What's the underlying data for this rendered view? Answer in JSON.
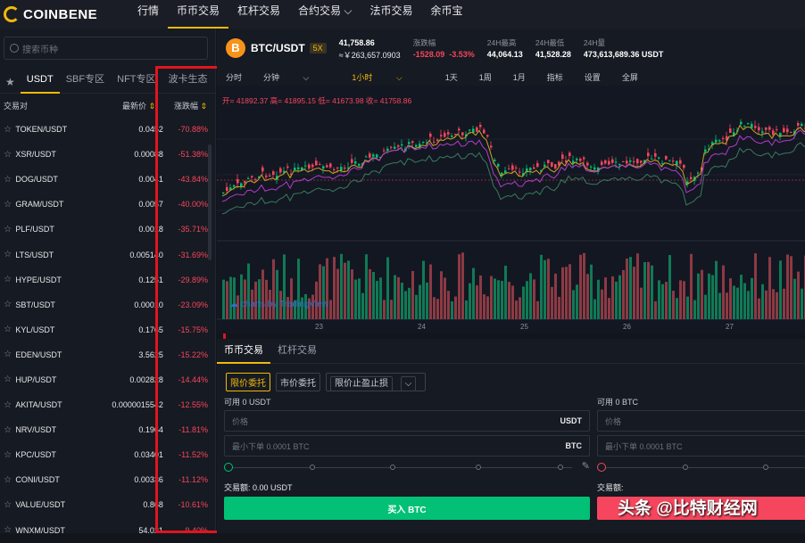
{
  "nav": {
    "logo": "COINBENE",
    "items": [
      "行情",
      "币币交易",
      "杠杆交易",
      "合约交易",
      "法币交易",
      "余币宝"
    ]
  },
  "sidebar": {
    "search_placeholder": "搜索币种",
    "tabs": [
      "USDT",
      "SBF专区",
      "NFT专区",
      "波卡生态"
    ],
    "col_pair": "交易对",
    "col_price": "最新价",
    "col_change": "涨跌幅",
    "rows": [
      {
        "pair": "TOKEN/USDT",
        "price": "0.0452",
        "change": "-70.88%"
      },
      {
        "pair": "XSR/USDT",
        "price": "0.00088",
        "change": "-51.38%"
      },
      {
        "pair": "DOG/USDT",
        "price": "0.0041",
        "change": "-43.84%"
      },
      {
        "pair": "GRAM/USDT",
        "price": "0.0057",
        "change": "-40.00%"
      },
      {
        "pair": "PLF/USDT",
        "price": "0.0018",
        "change": "-35.71%"
      },
      {
        "pair": "LTS/USDT",
        "price": "0.005140",
        "change": "-31.69%"
      },
      {
        "pair": "HYPE/USDT",
        "price": "0.1251",
        "change": "-29.89%"
      },
      {
        "pair": "SBT/USDT",
        "price": "0.00010",
        "change": "-23.09%"
      },
      {
        "pair": "KYL/USDT",
        "price": "0.1765",
        "change": "-15.75%"
      },
      {
        "pair": "EDEN/USDT",
        "price": "3.5625",
        "change": "-15.22%"
      },
      {
        "pair": "HUP/USDT",
        "price": "0.002828",
        "change": "-14.44%"
      },
      {
        "pair": "AKITA/USDT",
        "price": "0.0000015542",
        "change": "-12.55%"
      },
      {
        "pair": "NRV/USDT",
        "price": "0.1964",
        "change": "-11.81%"
      },
      {
        "pair": "KPC/USDT",
        "price": "0.03401",
        "change": "-11.52%"
      },
      {
        "pair": "CONI/USDT",
        "price": "0.00336",
        "change": "-11.12%"
      },
      {
        "pair": "VALUE/USDT",
        "price": "0.868",
        "change": "-10.61%"
      },
      {
        "pair": "WNXM/USDT",
        "price": "54.021",
        "change": "-9.40%"
      }
    ]
  },
  "header": {
    "symbol": "B",
    "pair": "BTC/USDT",
    "leverage": "5X",
    "last_price": "41,758.86",
    "last_cny": "≈￥263,657.0903",
    "change_label": "涨跌幅",
    "change_abs": "-1528.09",
    "change_pct": "-3.53%",
    "high_label": "24H最高",
    "high": "44,064.13",
    "low_label": "24H最低",
    "low": "41,528.28",
    "vol_label": "24H量",
    "vol": "473,613,689.36 USDT"
  },
  "toolbar": [
    "分时",
    "分钟",
    "1小时",
    "1天",
    "1周",
    "1月",
    "指标",
    "设置",
    "全屏"
  ],
  "chart": {
    "ohlc": "开= 41892.37 高= 41895.15 低= 41673.98 收= 41758.86",
    "brand": "charts by TradingView",
    "date_ticks": [
      "23",
      "24",
      "25",
      "26",
      "27"
    ]
  },
  "trade": {
    "tabs": [
      "币币交易",
      "杠杆交易"
    ],
    "order_types": [
      "限价委托",
      "市价委托",
      "限价止盈止损"
    ],
    "buy_avail": "可用 0 USDT",
    "sell_avail": "可用 0 BTC",
    "price_placeholder": "价格",
    "qty_placeholder": "最小下单 0.0001 BTC",
    "unit_usdt": "USDT",
    "unit_btc": "BTC",
    "amount": "交易额: 0.00 USDT",
    "sell_amount": "交易额:",
    "buy_button": "买入 BTC"
  },
  "watermark": "头条 @比特财经网"
}
